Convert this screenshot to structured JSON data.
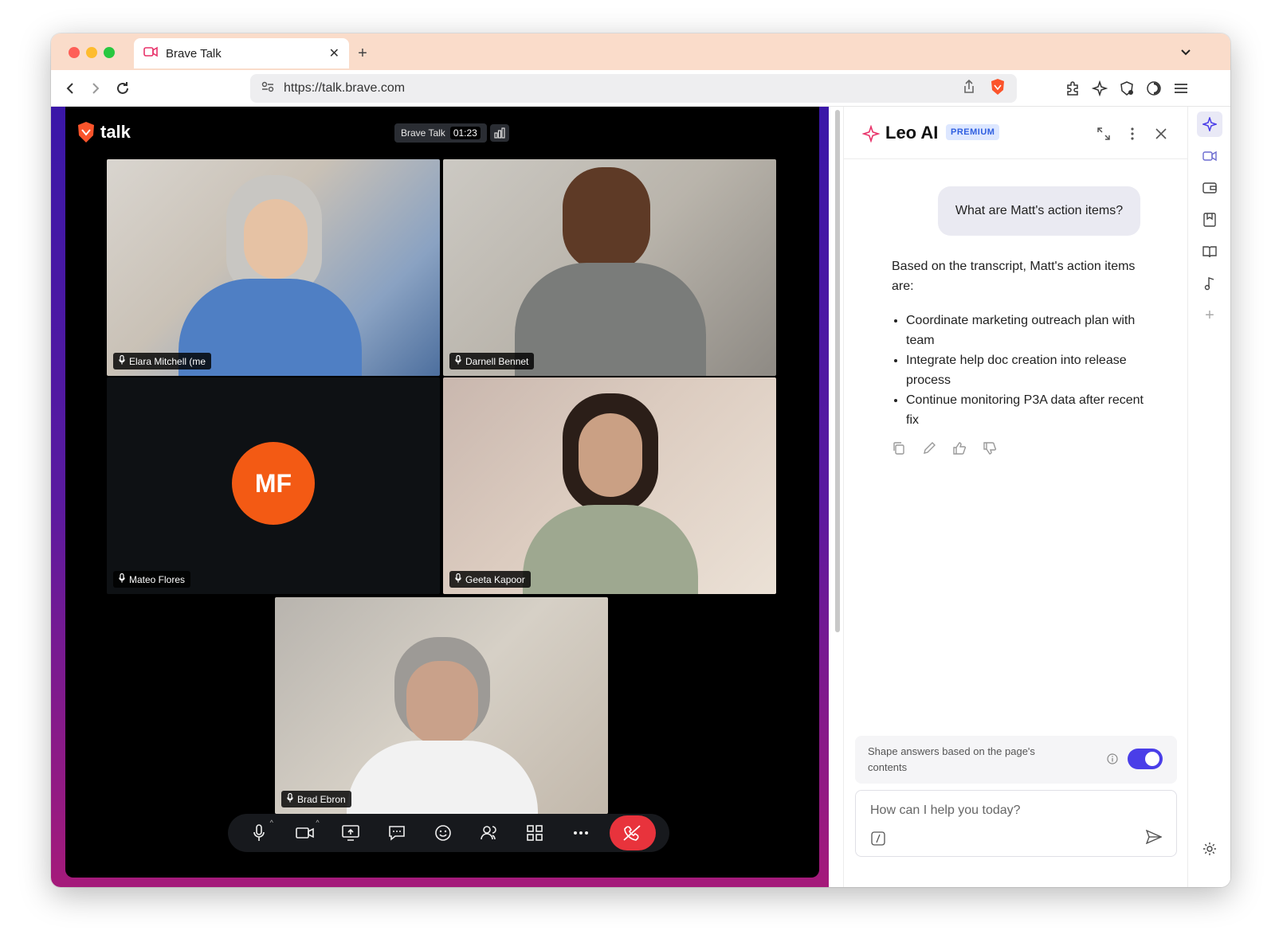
{
  "browser": {
    "tab_title": "Brave Talk",
    "url": "https://talk.brave.com"
  },
  "meeting": {
    "logo_text": "talk",
    "room_label": "Brave Talk",
    "timer": "01:23",
    "participants": [
      {
        "name": "Elara Mitchell (me"
      },
      {
        "name": "Darnell Bennet"
      },
      {
        "name": "Mateo Flores",
        "initials": "MF"
      },
      {
        "name": "Geeta Kapoor"
      },
      {
        "name": "Brad Ebron"
      }
    ]
  },
  "leo": {
    "title": "Leo AI",
    "badge": "PREMIUM",
    "question": "What are Matt's action items?",
    "answer_intro": "Based on the transcript, Matt's action items are:",
    "answer_items": [
      "Coordinate marketing outreach plan with team",
      "Integrate help doc creation into release process",
      "Continue monitoring P3A data after recent fix"
    ],
    "shape_label": "Shape answers based on the page's contents",
    "shape_enabled": true,
    "input_placeholder": "How can I help you today?"
  },
  "colors": {
    "accent": "#4a3ee8",
    "hangup": "#e8333c",
    "avatar": "#f35a14",
    "brave_orange": "#fb542b"
  }
}
